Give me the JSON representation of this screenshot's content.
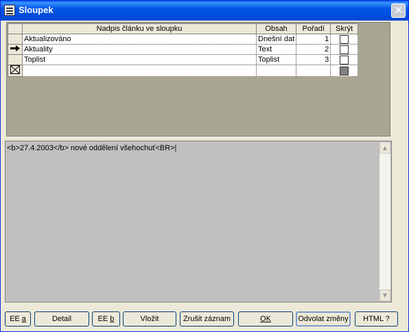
{
  "window": {
    "title": "Sloupek",
    "close_glyph": "✕"
  },
  "grid": {
    "columns": [
      "Nadpis článku ve sloupku",
      "Obsah",
      "Pořadí",
      "Skrýt"
    ],
    "rows": [
      {
        "title": "Aktualizováno",
        "content": "Dnešní dat",
        "order": "1",
        "hidden": false,
        "marker": ""
      },
      {
        "title": "Aktuality",
        "content": "Text",
        "order": "2",
        "hidden": false,
        "marker": "arrow"
      },
      {
        "title": "Toplist",
        "content": "Toplist",
        "order": "3",
        "hidden": false,
        "marker": ""
      }
    ]
  },
  "editor": {
    "content": "<b>27.4.2003</b> nové oddělení všehochuť<BR>|"
  },
  "buttons": {
    "ee_a": {
      "label": "EE ",
      "accel": "a"
    },
    "detail": {
      "label": "Detail"
    },
    "ee_b": {
      "label": "EE ",
      "accel": "b"
    },
    "vlozit": {
      "label": "Vložit"
    },
    "zrusit": {
      "label": "Zrušit záznam"
    },
    "ok": {
      "label": "OK"
    },
    "odvolat": {
      "label": "Odvolat změny"
    },
    "html": {
      "label": "HTML ?"
    }
  }
}
